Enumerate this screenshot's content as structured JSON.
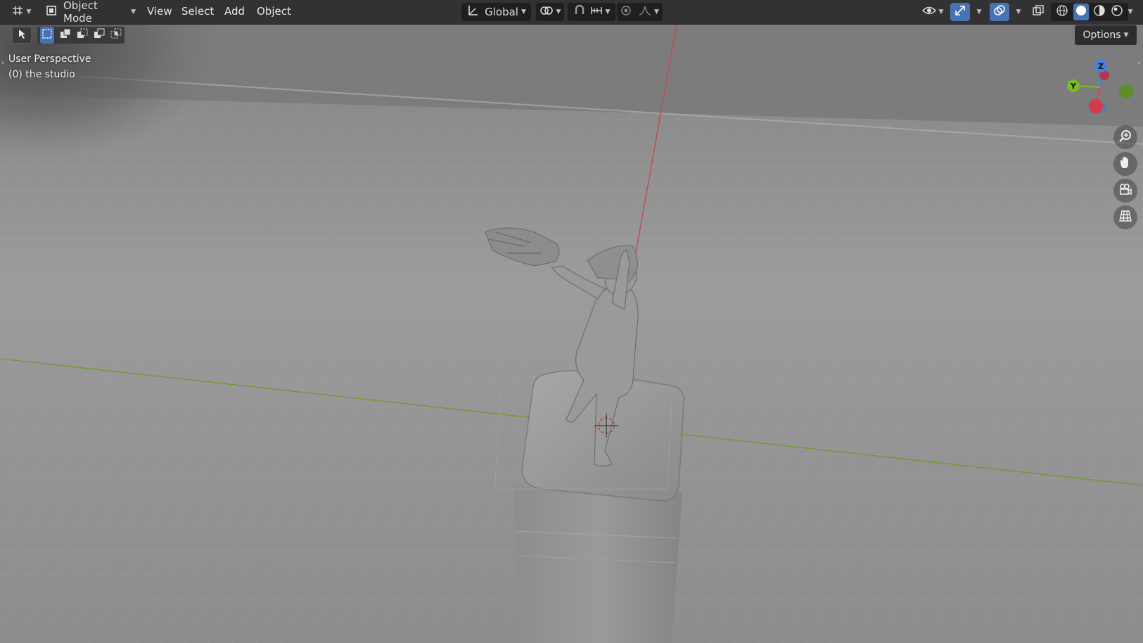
{
  "header": {
    "editor_type_icon": "editor-type-icon",
    "mode_label": "Object Mode",
    "menus": [
      "View",
      "Select",
      "Add",
      "Object"
    ],
    "orientation_label": "Global",
    "options_label": "Options"
  },
  "overlay": {
    "line1": "User Perspective",
    "line2": "(0) the studio"
  },
  "gizmo": {
    "z_label": "Z",
    "y_label": "Y",
    "colors": {
      "x": "#e0404e",
      "y": "#7dba2a",
      "z": "#3f82e6"
    }
  },
  "nav_icons": [
    "zoom-icon",
    "hand-pan-icon",
    "camera-icon",
    "grid-ortho-icon"
  ],
  "colors": {
    "header_bg": "#303030",
    "accent": "#4772b3",
    "x_axis_line": "#c8454a",
    "y_axis_line": "#6d9a2e"
  }
}
